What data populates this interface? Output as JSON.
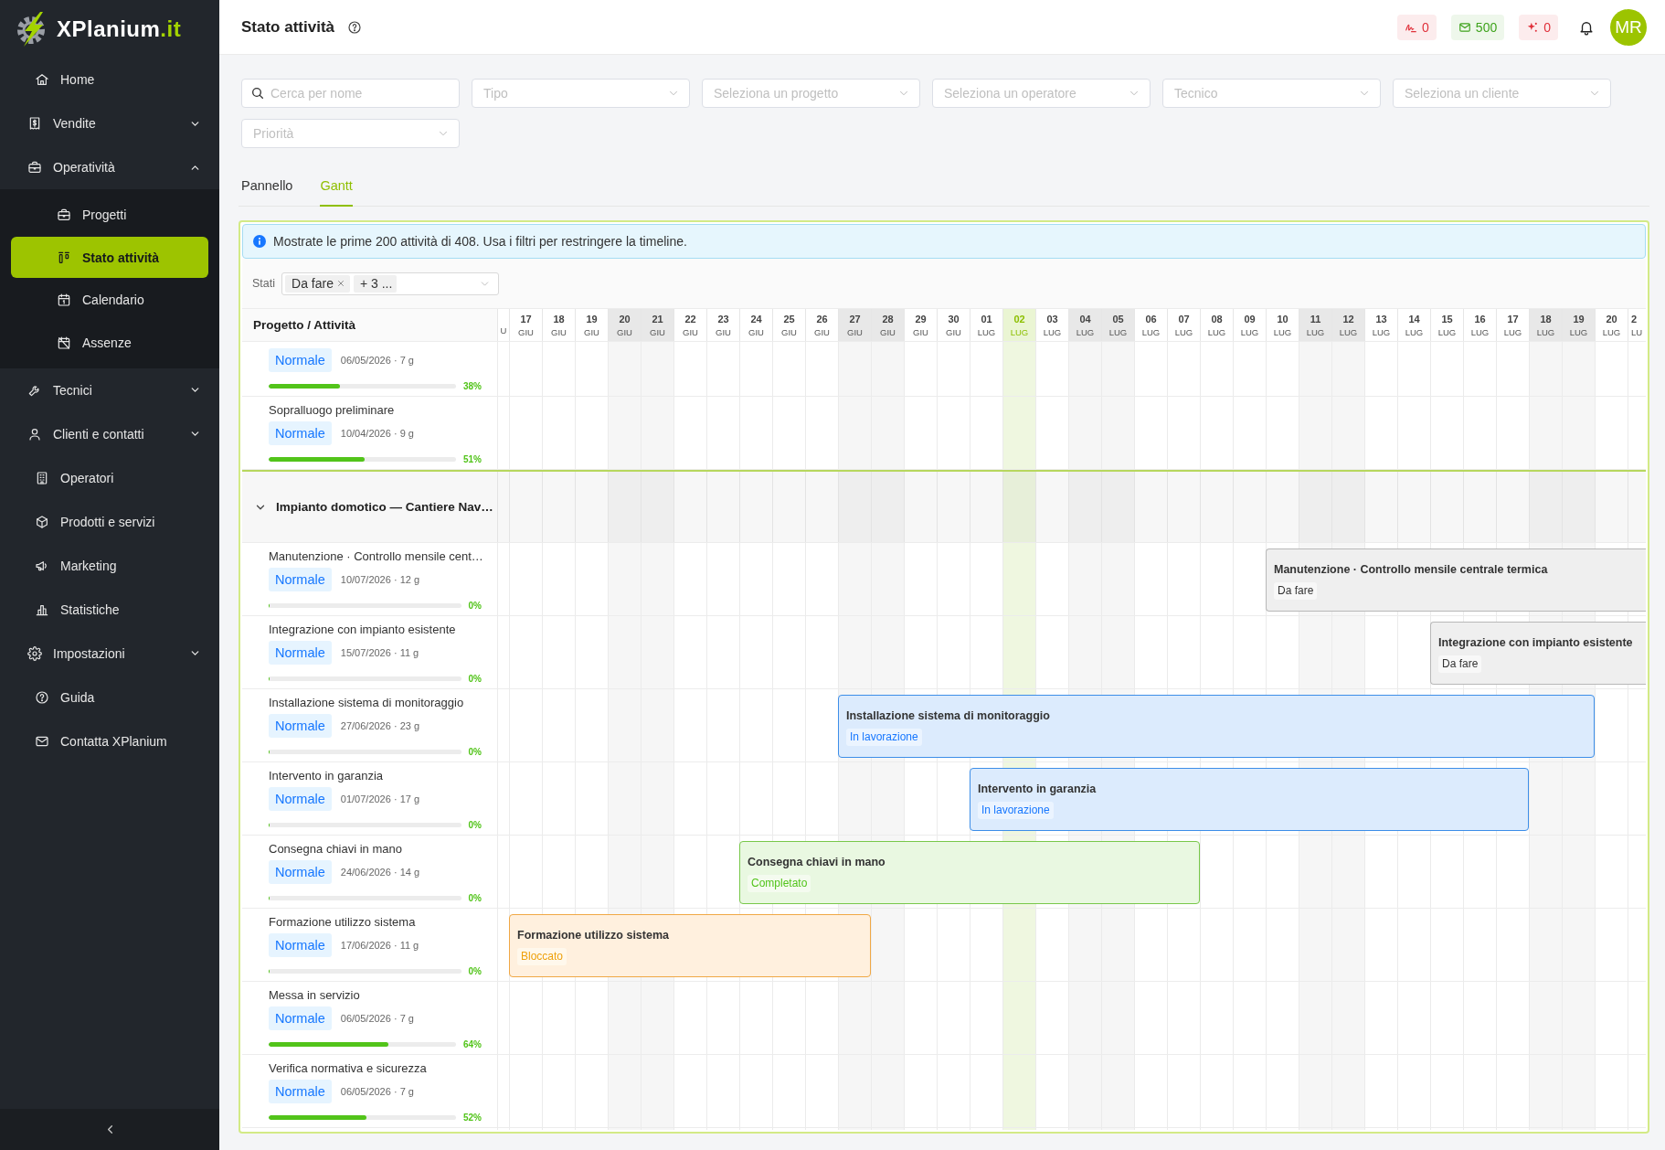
{
  "sidebar": {
    "logo": {
      "name": "XPlanium",
      "suffix": ".it"
    },
    "items": [
      {
        "label": "Home",
        "kind": "link",
        "selected": false
      },
      {
        "label": "Vendite",
        "kind": "group",
        "expanded": false,
        "selected": false
      },
      {
        "label": "Operatività",
        "kind": "group",
        "expanded": true,
        "selected": false,
        "children": [
          {
            "label": "Progetti",
            "selected": false
          },
          {
            "label": "Stato attività",
            "selected": true
          },
          {
            "label": "Calendario",
            "selected": false
          },
          {
            "label": "Assenze",
            "selected": false
          }
        ]
      },
      {
        "label": "Tecnici",
        "kind": "group",
        "expanded": false,
        "selected": false
      },
      {
        "label": "Clienti e contatti",
        "kind": "group",
        "expanded": false,
        "selected": false
      },
      {
        "label": "Operatori",
        "kind": "link",
        "selected": false
      },
      {
        "label": "Prodotti e servizi",
        "kind": "link",
        "selected": false
      },
      {
        "label": "Marketing",
        "kind": "link",
        "selected": false
      },
      {
        "label": "Statistiche",
        "kind": "link",
        "selected": false
      },
      {
        "label": "Impostazioni",
        "kind": "group",
        "expanded": false,
        "selected": false
      },
      {
        "label": "Guida",
        "kind": "link",
        "selected": false
      },
      {
        "label": "Contatta XPlanium",
        "kind": "link",
        "selected": false
      }
    ]
  },
  "header": {
    "title": "Stato attività",
    "counters": [
      {
        "value": "0",
        "color": "#e0303a"
      },
      {
        "value": "500",
        "color": "#3ea31c"
      },
      {
        "value": "0",
        "color": "#e0303a"
      }
    ],
    "avatar": "MR"
  },
  "filters": [
    {
      "kind": "search",
      "placeholder": "Cerca per nome"
    },
    {
      "kind": "select",
      "placeholder": "Tipo"
    },
    {
      "kind": "select",
      "placeholder": "Seleziona un progetto"
    },
    {
      "kind": "select",
      "placeholder": "Seleziona un operatore"
    },
    {
      "kind": "select",
      "placeholder": "Tecnico"
    },
    {
      "kind": "select",
      "placeholder": "Seleziona un cliente"
    },
    {
      "kind": "select",
      "placeholder": "Priorità"
    }
  ],
  "tabs": [
    {
      "label": "Pannello",
      "selected": false
    },
    {
      "label": "Gantt",
      "selected": true
    }
  ],
  "gantt": {
    "notice": "Mostrate le prime 200 attività di 408. Usa i filtri per restringere la timeline.",
    "status_filter": {
      "label": "Stati",
      "chips": [
        {
          "label": "Da fare",
          "removable": true
        },
        {
          "label": "+ 3 ...",
          "removable": false
        }
      ]
    },
    "column_header": "Progetto / Attività",
    "days": [
      {
        "month": "U",
        "weekend": false,
        "today": false
      },
      {
        "day": "17",
        "month": "GIU",
        "weekend": false,
        "today": false
      },
      {
        "day": "18",
        "month": "GIU",
        "weekend": false,
        "today": false
      },
      {
        "day": "19",
        "month": "GIU",
        "weekend": false,
        "today": false
      },
      {
        "day": "20",
        "month": "GIU",
        "weekend": true,
        "today": false
      },
      {
        "day": "21",
        "month": "GIU",
        "weekend": true,
        "today": false
      },
      {
        "day": "22",
        "month": "GIU",
        "weekend": false,
        "today": false
      },
      {
        "day": "23",
        "month": "GIU",
        "weekend": false,
        "today": false
      },
      {
        "day": "24",
        "month": "GIU",
        "weekend": false,
        "today": false
      },
      {
        "day": "25",
        "month": "GIU",
        "weekend": false,
        "today": false
      },
      {
        "day": "26",
        "month": "GIU",
        "weekend": false,
        "today": false
      },
      {
        "day": "27",
        "month": "GIU",
        "weekend": true,
        "today": false
      },
      {
        "day": "28",
        "month": "GIU",
        "weekend": true,
        "today": false
      },
      {
        "day": "29",
        "month": "GIU",
        "weekend": false,
        "today": false
      },
      {
        "day": "30",
        "month": "GIU",
        "weekend": false,
        "today": false
      },
      {
        "day": "01",
        "month": "LUG",
        "weekend": false,
        "today": false
      },
      {
        "day": "02",
        "month": "LUG",
        "weekend": false,
        "today": true
      },
      {
        "day": "03",
        "month": "LUG",
        "weekend": false,
        "today": false
      },
      {
        "day": "04",
        "month": "LUG",
        "weekend": true,
        "today": false
      },
      {
        "day": "05",
        "month": "LUG",
        "weekend": true,
        "today": false
      },
      {
        "day": "06",
        "month": "LUG",
        "weekend": false,
        "today": false
      },
      {
        "day": "07",
        "month": "LUG",
        "weekend": false,
        "today": false
      },
      {
        "day": "08",
        "month": "LUG",
        "weekend": false,
        "today": false
      },
      {
        "day": "09",
        "month": "LUG",
        "weekend": false,
        "today": false
      },
      {
        "day": "10",
        "month": "LUG",
        "weekend": false,
        "today": false
      },
      {
        "day": "11",
        "month": "LUG",
        "weekend": true,
        "today": false
      },
      {
        "day": "12",
        "month": "LUG",
        "weekend": true,
        "today": false
      },
      {
        "day": "13",
        "month": "LUG",
        "weekend": false,
        "today": false
      },
      {
        "day": "14",
        "month": "LUG",
        "weekend": false,
        "today": false
      },
      {
        "day": "15",
        "month": "LUG",
        "weekend": false,
        "today": false
      },
      {
        "day": "16",
        "month": "LUG",
        "weekend": false,
        "today": false
      },
      {
        "day": "17",
        "month": "LUG",
        "weekend": false,
        "today": false
      },
      {
        "day": "18",
        "month": "LUG",
        "weekend": true,
        "today": false
      },
      {
        "day": "19",
        "month": "LUG",
        "weekend": true,
        "today": false
      },
      {
        "day": "20",
        "month": "LUG",
        "weekend": false,
        "today": false
      },
      {
        "day": "2",
        "month": "LU",
        "weekend": false,
        "today": false
      }
    ],
    "groups": [
      {
        "tasks": [
          {
            "priority": "Normale",
            "schedule": "06/05/2026 · 7 g",
            "progress": "38%",
            "level": 0.38
          },
          {
            "title": "Sopralluogo preliminare",
            "priority": "Normale",
            "schedule": "10/04/2026 · 9 g",
            "progress": "51%",
            "level": 0.51
          }
        ]
      },
      {
        "title": "Impianto domotico — Cantiere Nav…",
        "expanded": true,
        "tasks": [
          {
            "title": "Manutenzione · Controllo mensile cent…",
            "priority": "Normale",
            "schedule": "10/07/2026 · 12 g",
            "progress": "0%",
            "level": 0,
            "bar": {
              "title": "Manutenzione · Controllo mensile centrale termica",
              "status": "Da fare",
              "kind": "todo"
            }
          },
          {
            "title": "Integrazione con impianto esistente",
            "priority": "Normale",
            "schedule": "15/07/2026 · 11 g",
            "progress": "0%",
            "level": 0,
            "bar": {
              "title": "Integrazione con impianto esistente",
              "status": "Da fare",
              "kind": "todo"
            }
          },
          {
            "title": "Installazione sistema di monitoraggio",
            "priority": "Normale",
            "schedule": "27/06/2026 · 23 g",
            "progress": "0%",
            "level": 0,
            "bar": {
              "title": "Installazione sistema di monitoraggio",
              "status": "In lavorazione",
              "kind": "progress"
            }
          },
          {
            "title": "Intervento in garanzia",
            "priority": "Normale",
            "schedule": "01/07/2026 · 17 g",
            "progress": "0%",
            "level": 0,
            "bar": {
              "title": "Intervento in garanzia",
              "status": "In lavorazione",
              "kind": "progress"
            }
          },
          {
            "title": "Consegna chiavi in mano",
            "priority": "Normale",
            "schedule": "24/06/2026 · 14 g",
            "progress": "0%",
            "level": 0,
            "bar": {
              "title": "Consegna chiavi in mano",
              "status": "Completato",
              "kind": "done"
            }
          },
          {
            "title": "Formazione utilizzo sistema",
            "priority": "Normale",
            "schedule": "17/06/2026 · 11 g",
            "progress": "0%",
            "level": 0,
            "bar": {
              "title": "Formazione utilizzo sistema",
              "status": "Bloccato",
              "kind": "blocked"
            }
          },
          {
            "title": "Messa in servizio",
            "priority": "Normale",
            "schedule": "06/05/2026 · 7 g",
            "progress": "64%",
            "level": 0.64
          },
          {
            "title": "Verifica normativa e sicurezza",
            "priority": "Normale",
            "schedule": "06/05/2026 · 7 g",
            "progress": "52%",
            "level": 0.52
          }
        ]
      }
    ]
  }
}
